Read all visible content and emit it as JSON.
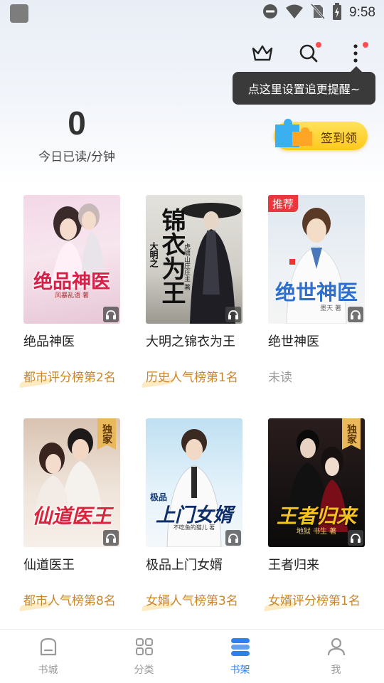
{
  "status_bar": {
    "time": "9:58"
  },
  "toolbar": {
    "tooltip": "点这里设置追更提醒~"
  },
  "stats": {
    "count": "0",
    "label": "今日已读/分钟"
  },
  "signin": {
    "label": "签到领"
  },
  "books": [
    {
      "title": "绝品神医",
      "cover_text": "绝品神医",
      "cover_sub": "风暴乱语 著",
      "rank": "都市评分榜第2名",
      "tag": ""
    },
    {
      "title": "大明之锦衣为王",
      "cover_text": "锦衣为王",
      "cover_sub": "虎啸山庄庄主 著",
      "cover_prefix": "大明之",
      "rank": "历史人气榜第1名",
      "tag": ""
    },
    {
      "title": "绝世神医",
      "cover_text": "绝世神医",
      "cover_sub": "墨天 著",
      "rank": "未读",
      "tag": "推荐"
    },
    {
      "title": "仙道医王",
      "cover_text": "仙道医王",
      "cover_sub": "",
      "rank": "都市人气榜第8名",
      "tag": "独家"
    },
    {
      "title": "极品上门女婿",
      "cover_text": "上门女婿",
      "cover_prefix": "极品",
      "cover_sub": "不吃鱼的猫儿 著",
      "rank": "女婿人气榜第3名",
      "tag": ""
    },
    {
      "title": "王者归来",
      "cover_text": "王者归来",
      "cover_sub": "地狱 书生 著",
      "rank": "女婿评分榜第1名",
      "tag": "独家"
    }
  ],
  "bottom_nav": [
    {
      "label": "书城",
      "icon": "bookstore-icon",
      "active": false
    },
    {
      "label": "分类",
      "icon": "category-icon",
      "active": false
    },
    {
      "label": "书架",
      "icon": "bookshelf-icon",
      "active": true
    },
    {
      "label": "我",
      "icon": "profile-icon",
      "active": false
    }
  ],
  "colors": {
    "accent": "#2f80ed",
    "rank": "#c8862c",
    "badge_red": "#e8383d",
    "signin_yellow": "#ffc91c"
  }
}
